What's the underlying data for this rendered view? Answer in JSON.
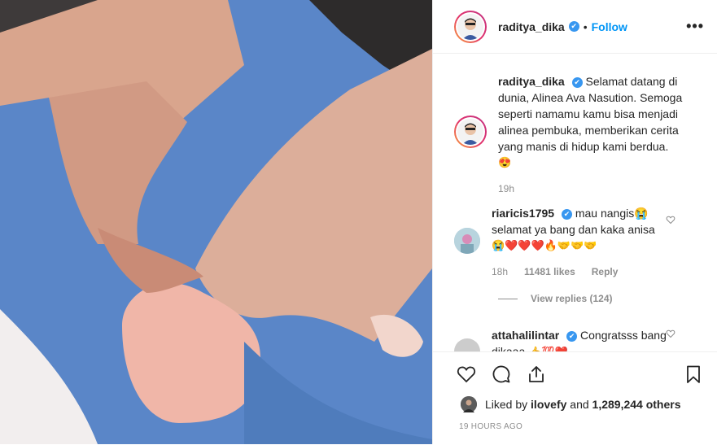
{
  "post": {
    "username": "raditya_dika",
    "verified_mark": "✔",
    "separator": "•",
    "follow_label": "Follow",
    "more_label": "•••"
  },
  "caption": {
    "username": "raditya_dika",
    "text": "Selamat datang di dunia, Alinea Ava Nasution. Semoga seperti namamu kamu bisa menjadi alinea pembuka, memberikan cerita yang manis di hidup kami berdua.",
    "emoji": "😍",
    "time": "19h"
  },
  "comments": [
    {
      "username": "riaricis1795",
      "text": "mau nangis😭 selamat ya bang dan kaka anisa",
      "emojis": "😭❤️❤️❤️🔥🤝🤝🤝",
      "time": "18h",
      "likes": "11481 likes",
      "reply_label": "Reply",
      "view_replies": "View replies (124)"
    },
    {
      "username": "attahalilintar",
      "text": "Congratsss bang dikaaa",
      "emojis": "👍💯❤️"
    }
  ],
  "actions": {
    "liked_by_prefix": "Liked by",
    "liked_by_user": "ilovefy",
    "liked_by_and": "and",
    "liked_by_count": "1,289,244 others",
    "timestamp": "19 HOURS AGO"
  },
  "icons": {
    "like": "heart-icon",
    "comment": "comment-icon",
    "share": "share-icon",
    "save": "bookmark-icon",
    "comment_like": "small-heart-icon"
  },
  "colors": {
    "accent": "#0095f6",
    "verified": "#3897f0",
    "photo_blue": "#5b87c9"
  }
}
